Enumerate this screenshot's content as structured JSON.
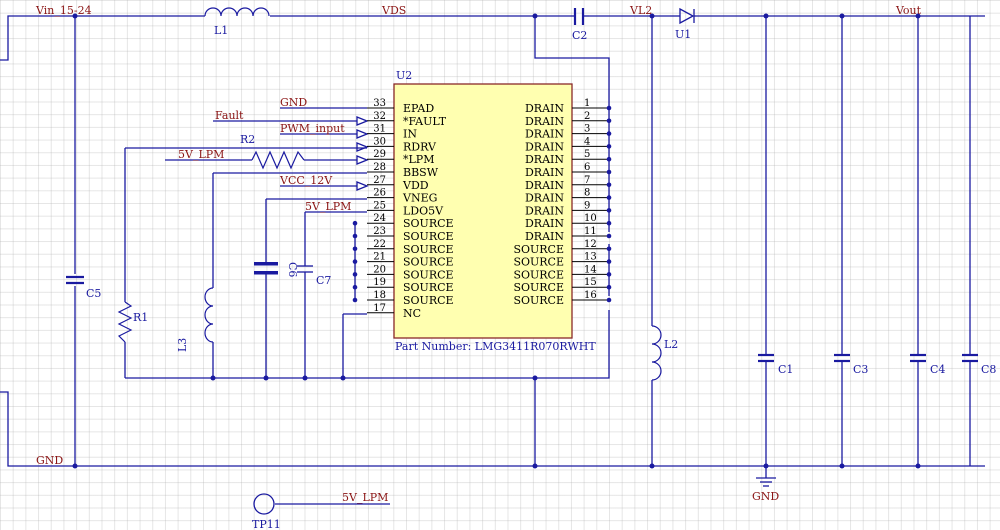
{
  "net_labels": {
    "vin": "Vin_15-24",
    "vds": "VDS",
    "vl2": "VL2",
    "vout": "Vout",
    "gnd_left": "GND",
    "gnd_symbol": "GND",
    "gnd_pin": "GND",
    "fault": "Fault",
    "pwm": "PWM_input",
    "lpm_left": "5V_LPM",
    "vcc": "VCC_12V",
    "lpm_ldo": "5V_LPM",
    "lpm_tp": "5V_LPM"
  },
  "designators": {
    "L1": "L1",
    "L2": "L2",
    "L3": "L3",
    "C1": "C1",
    "C2": "C2",
    "C3": "C3",
    "C4": "C4",
    "C5": "C5",
    "C6": "C6",
    "C7": "C7",
    "C8": "C8",
    "R1": "R1",
    "R2": "R2",
    "U1": "U1",
    "U2": "U2",
    "TP11": "TP11"
  },
  "ic": {
    "part_number": "Part Number: LMG3411R070RWHT",
    "left_pins": [
      {
        "num": "33",
        "name": "EPAD"
      },
      {
        "num": "32",
        "name": "*FAULT"
      },
      {
        "num": "31",
        "name": "IN"
      },
      {
        "num": "30",
        "name": "RDRV"
      },
      {
        "num": "29",
        "name": "*LPM"
      },
      {
        "num": "28",
        "name": "BBSW"
      },
      {
        "num": "27",
        "name": "VDD"
      },
      {
        "num": "26",
        "name": "VNEG"
      },
      {
        "num": "25",
        "name": "LDO5V"
      },
      {
        "num": "24",
        "name": "SOURCE"
      },
      {
        "num": "23",
        "name": "SOURCE"
      },
      {
        "num": "22",
        "name": "SOURCE"
      },
      {
        "num": "21",
        "name": "SOURCE"
      },
      {
        "num": "20",
        "name": "SOURCE"
      },
      {
        "num": "19",
        "name": "SOURCE"
      },
      {
        "num": "18",
        "name": "SOURCE"
      },
      {
        "num": "17",
        "name": "NC"
      }
    ],
    "right_pins": [
      {
        "num": "1",
        "name": "DRAIN"
      },
      {
        "num": "2",
        "name": "DRAIN"
      },
      {
        "num": "3",
        "name": "DRAIN"
      },
      {
        "num": "4",
        "name": "DRAIN"
      },
      {
        "num": "5",
        "name": "DRAIN"
      },
      {
        "num": "6",
        "name": "DRAIN"
      },
      {
        "num": "7",
        "name": "DRAIN"
      },
      {
        "num": "8",
        "name": "DRAIN"
      },
      {
        "num": "9",
        "name": "DRAIN"
      },
      {
        "num": "10",
        "name": "DRAIN"
      },
      {
        "num": "11",
        "name": "DRAIN"
      },
      {
        "num": "12",
        "name": "SOURCE"
      },
      {
        "num": "13",
        "name": "SOURCE"
      },
      {
        "num": "14",
        "name": "SOURCE"
      },
      {
        "num": "15",
        "name": "SOURCE"
      },
      {
        "num": "16",
        "name": "SOURCE"
      }
    ]
  },
  "colors": {
    "wire": "#1a1aa0",
    "net_label": "#8b1515",
    "ic_fill": "#ffffb0",
    "ic_border": "#8a2a2a",
    "grid": "#d8d8d8"
  }
}
